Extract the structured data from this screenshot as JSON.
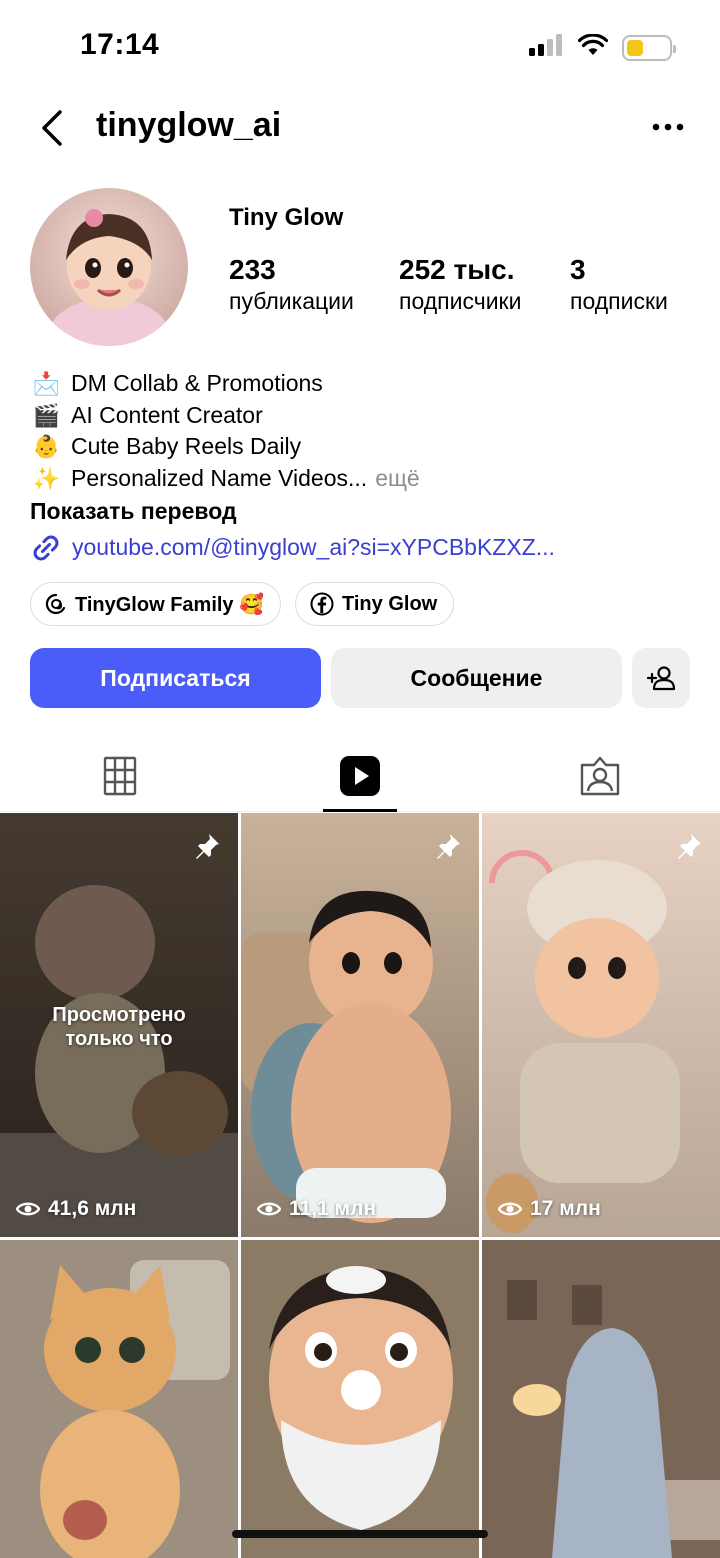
{
  "status_bar": {
    "time": "17:14"
  },
  "header": {
    "username": "tinyglow_ai"
  },
  "profile": {
    "display_name": "Tiny Glow",
    "stats": [
      {
        "value": "233",
        "label": "публикации"
      },
      {
        "value": "252 тыс.",
        "label": "подписчики"
      },
      {
        "value": "3",
        "label": "подписки"
      }
    ]
  },
  "bio": {
    "lines": [
      {
        "emoji": "📩",
        "text": "DM Collab & Promotions"
      },
      {
        "emoji": "🎬",
        "text": "AI Content Creator"
      },
      {
        "emoji": "👶",
        "text": "Cute Baby Reels Daily"
      },
      {
        "emoji": "✨",
        "text": "Personalized Name Videos..."
      }
    ],
    "more": "ещё",
    "translate": "Показать перевод",
    "link": "youtube.com/@tinyglow_ai?si=xYPCBbKZXZ..."
  },
  "chips": [
    {
      "label": "TinyGlow Family 🥰",
      "icon": "threads-icon"
    },
    {
      "label": "Tiny Glow",
      "icon": "facebook-icon"
    }
  ],
  "actions": {
    "follow": "Подписаться",
    "message": "Сообщение"
  },
  "tabs": [
    {
      "icon": "grid-icon"
    },
    {
      "icon": "reels-icon",
      "active": true
    },
    {
      "icon": "tagged-icon"
    }
  ],
  "grid": [
    {
      "views": "41,6 млн",
      "pinned": true,
      "overlay": "Просмотрено\nтолько что"
    },
    {
      "views": "11,1 млн",
      "pinned": true
    },
    {
      "views": "17 млн",
      "pinned": true
    },
    {
      "views": "",
      "pinned": false
    },
    {
      "views": "",
      "pinned": false
    },
    {
      "views": "",
      "pinned": false
    }
  ],
  "colors": {
    "accent": "#4a5df9",
    "link": "#3b3fd1",
    "muted": "#8e8e8e"
  }
}
